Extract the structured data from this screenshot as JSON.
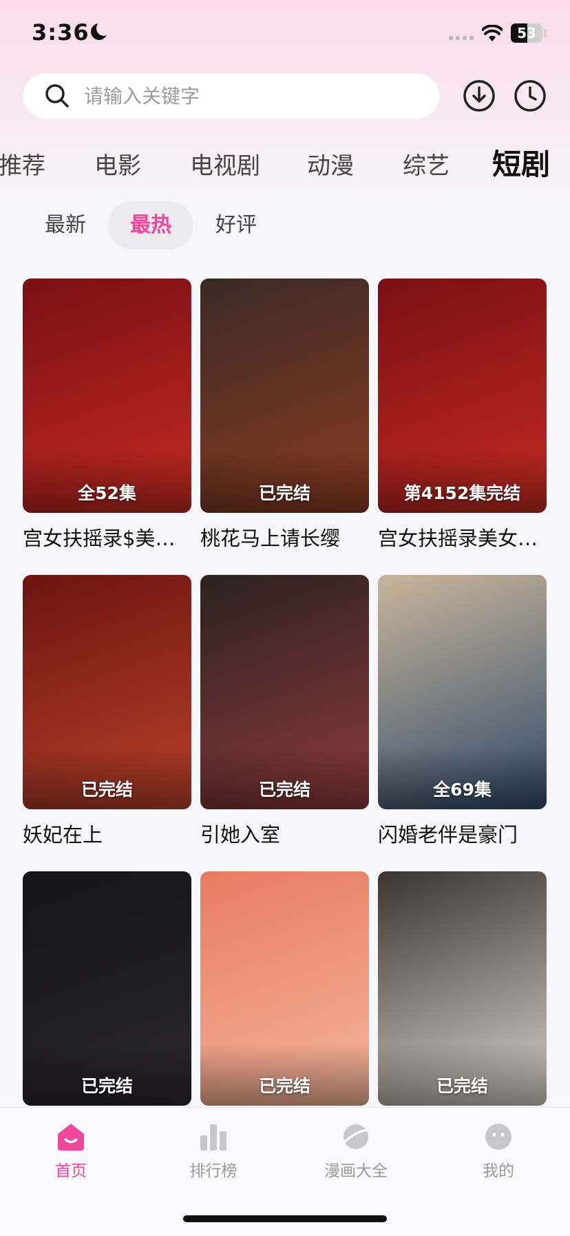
{
  "status_bar": {
    "time": "3:36",
    "battery_text": "53",
    "battery_level": 0.53
  },
  "search": {
    "placeholder": "请输入关键字"
  },
  "icons": {
    "download": "download-icon",
    "history": "clock-icon"
  },
  "category_tabs": [
    {
      "label": "推荐",
      "active": false
    },
    {
      "label": "电影",
      "active": false
    },
    {
      "label": "电视剧",
      "active": false
    },
    {
      "label": "动漫",
      "active": false
    },
    {
      "label": "综艺",
      "active": false
    },
    {
      "label": "短剧",
      "active": true
    }
  ],
  "sort_tabs": [
    {
      "label": "最新",
      "active": false
    },
    {
      "label": "最热",
      "active": true
    },
    {
      "label": "好评",
      "active": false
    }
  ],
  "cards": [
    {
      "title": "宫女扶摇录$美女与生活",
      "badge": "全52集",
      "colors": [
        "#7a0f14",
        "#c32a22"
      ]
    },
    {
      "title": "桃花马上请长缨",
      "badge": "已完结",
      "colors": [
        "#3a2a25",
        "#8a3b22"
      ]
    },
    {
      "title": "宫女扶摇录美女与生活",
      "badge": "第4152集完结",
      "colors": [
        "#7a0f14",
        "#c32a22"
      ]
    },
    {
      "title": "妖妃在上",
      "badge": "已完结",
      "colors": [
        "#6b1410",
        "#b8402a"
      ]
    },
    {
      "title": "引她入室",
      "badge": "已完结",
      "colors": [
        "#2a2220",
        "#8d3a3a"
      ]
    },
    {
      "title": "闪婚老伴是豪门",
      "badge": "全69集",
      "colors": [
        "#c9b59a",
        "#2f4a6b"
      ]
    },
    {
      "title": "",
      "badge": "已完结",
      "colors": [
        "#141418",
        "#2b2730"
      ]
    },
    {
      "title": "",
      "badge": "已完结",
      "colors": [
        "#e77b62",
        "#f4b69c"
      ]
    },
    {
      "title": "",
      "badge": "已完结",
      "colors": [
        "#3c352f",
        "#d7d2cc"
      ]
    }
  ],
  "bottom_nav": [
    {
      "label": "首页",
      "icon": "home-icon",
      "active": true
    },
    {
      "label": "排行榜",
      "icon": "ranking-bar-icon",
      "active": false
    },
    {
      "label": "漫画大全",
      "icon": "planet-icon",
      "active": false
    },
    {
      "label": "我的",
      "icon": "profile-face-icon",
      "active": false
    }
  ],
  "theme": {
    "accent": "#f0479b"
  }
}
